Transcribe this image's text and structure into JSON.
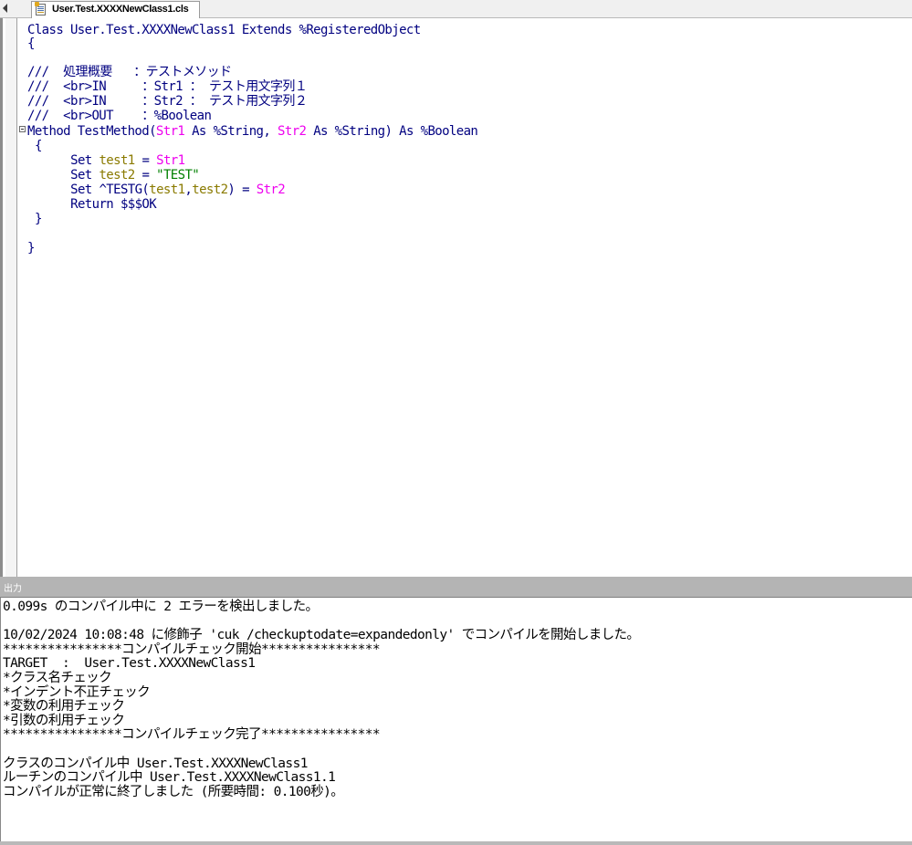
{
  "tab": {
    "title": "User.Test.XXXXNewClass1.cls"
  },
  "editor": {
    "lines": [
      {
        "segs": [
          {
            "t": "Class User.Test.XXXXNewClass1 Extends %RegisteredObject",
            "c": "kw"
          }
        ]
      },
      {
        "segs": [
          {
            "t": "{",
            "c": "kw"
          }
        ]
      },
      {
        "segs": []
      },
      {
        "segs": [
          {
            "t": "///  処理概要   ：テストメソッド",
            "c": "cm"
          }
        ]
      },
      {
        "segs": [
          {
            "t": "///  <br>IN     ：Str1 ： テスト用文字列１",
            "c": "cm"
          }
        ]
      },
      {
        "segs": [
          {
            "t": "///  <br>IN     ：Str2 ： テスト用文字列２",
            "c": "cm"
          }
        ]
      },
      {
        "segs": [
          {
            "t": "///  <br>OUT    ：%Boolean",
            "c": "cm"
          }
        ]
      },
      {
        "segs": [
          {
            "t": "Method TestMethod(",
            "c": "kw"
          },
          {
            "t": "Str1",
            "c": "arg"
          },
          {
            "t": " As %String, ",
            "c": "kw"
          },
          {
            "t": "Str2",
            "c": "arg"
          },
          {
            "t": " As %String) As %Boolean",
            "c": "kw"
          }
        ]
      },
      {
        "segs": [
          {
            "t": "{",
            "c": "kw"
          }
        ]
      },
      {
        "segs": [
          {
            "t": "     Set ",
            "c": "kw"
          },
          {
            "t": "test1",
            "c": "var"
          },
          {
            "t": " = ",
            "c": "kw"
          },
          {
            "t": "Str1",
            "c": "arg"
          }
        ]
      },
      {
        "segs": [
          {
            "t": "     Set ",
            "c": "kw"
          },
          {
            "t": "test2",
            "c": "var"
          },
          {
            "t": " = ",
            "c": "kw"
          },
          {
            "t": "\"TEST\"",
            "c": "str"
          }
        ]
      },
      {
        "segs": [
          {
            "t": "     Set ^TESTG(",
            "c": "kw"
          },
          {
            "t": "test1",
            "c": "var"
          },
          {
            "t": ",",
            "c": "kw"
          },
          {
            "t": "test2",
            "c": "var"
          },
          {
            "t": ") = ",
            "c": "kw"
          },
          {
            "t": "Str2",
            "c": "arg"
          }
        ]
      },
      {
        "segs": [
          {
            "t": "     Return $$$OK",
            "c": "kw"
          }
        ]
      },
      {
        "segs": [
          {
            "t": "}",
            "c": "kw"
          }
        ]
      },
      {
        "segs": []
      },
      {
        "segs": [
          {
            "t": "}",
            "c": "kw"
          }
        ]
      }
    ]
  },
  "output": {
    "title": "出力",
    "lines": [
      "0.099s のコンパイル中に 2 エラーを検出しました。",
      "",
      "10/02/2024 10:08:48 に修飾子 'cuk /checkuptodate=expandedonly' でコンパイルを開始しました。",
      "****************コンパイルチェック開始****************",
      "TARGET  :  User.Test.XXXXNewClass1",
      "*クラス名チェック",
      "*インデント不正チェック",
      "*変数の利用チェック",
      "*引数の利用チェック",
      "****************コンパイルチェック完了****************",
      "",
      "クラスのコンパイル中 User.Test.XXXXNewClass1",
      "ルーチンのコンパイル中 User.Test.XXXXNewClass1.1",
      "コンパイルが正常に終了しました (所要時間: 0.100秒)。"
    ]
  },
  "colors": {
    "keyword": "#000080",
    "argument": "#ee00ee",
    "variable": "#8a7a00",
    "string": "#008000"
  }
}
